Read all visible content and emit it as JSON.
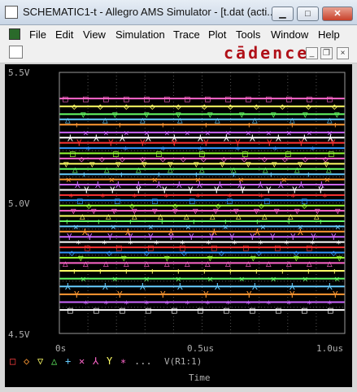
{
  "window": {
    "title": "SCHEMATIC1-t - Allegro AMS Simulator - [t.dat (acti...",
    "minimize_label": "▁",
    "maximize_label": "□",
    "close_label": "✕"
  },
  "menu": {
    "items": [
      "File",
      "Edit",
      "View",
      "Simulation",
      "Trace",
      "Plot",
      "Tools",
      "Window",
      "Help"
    ]
  },
  "toolbar": {
    "brand": "cādence",
    "mdi_minimize": "_",
    "mdi_restore": "❐",
    "mdi_close": "×"
  },
  "chart_data": {
    "type": "line",
    "title": "",
    "xlabel": "Time",
    "ylabel": "",
    "xlim": [
      0,
      1.0
    ],
    "ylim": [
      4.5,
      5.5
    ],
    "x_ticks": [
      "0s",
      "0.5us",
      "1.0us"
    ],
    "y_ticks": [
      "4.5V",
      "5.0V",
      "5.5V"
    ],
    "background": "#000000",
    "legend_symbols": [
      "□",
      "◇",
      "▽",
      "△",
      "+",
      "✕",
      "⅄",
      "Y",
      "∗",
      "..."
    ],
    "legend_trace_label": "V(R1:1)",
    "series_note_colors": [
      "#ff66cc",
      "#ffff66",
      "#66ff66",
      "#66ccff",
      "#ff9933",
      "#cc66ff",
      "#ffffff",
      "#ff3333",
      "#3399ff",
      "#99ff33"
    ],
    "series_levels": [
      5.4,
      5.37,
      5.34,
      5.32,
      5.3,
      5.27,
      5.25,
      5.23,
      5.21,
      5.19,
      5.17,
      5.15,
      5.13,
      5.11,
      5.09,
      5.07,
      5.05,
      5.03,
      5.01,
      4.99,
      4.97,
      4.95,
      4.93,
      4.91,
      4.89,
      4.87,
      4.85,
      4.83,
      4.81,
      4.79,
      4.77,
      4.74,
      4.71,
      4.68,
      4.65,
      4.62,
      4.59
    ],
    "grid": true
  }
}
